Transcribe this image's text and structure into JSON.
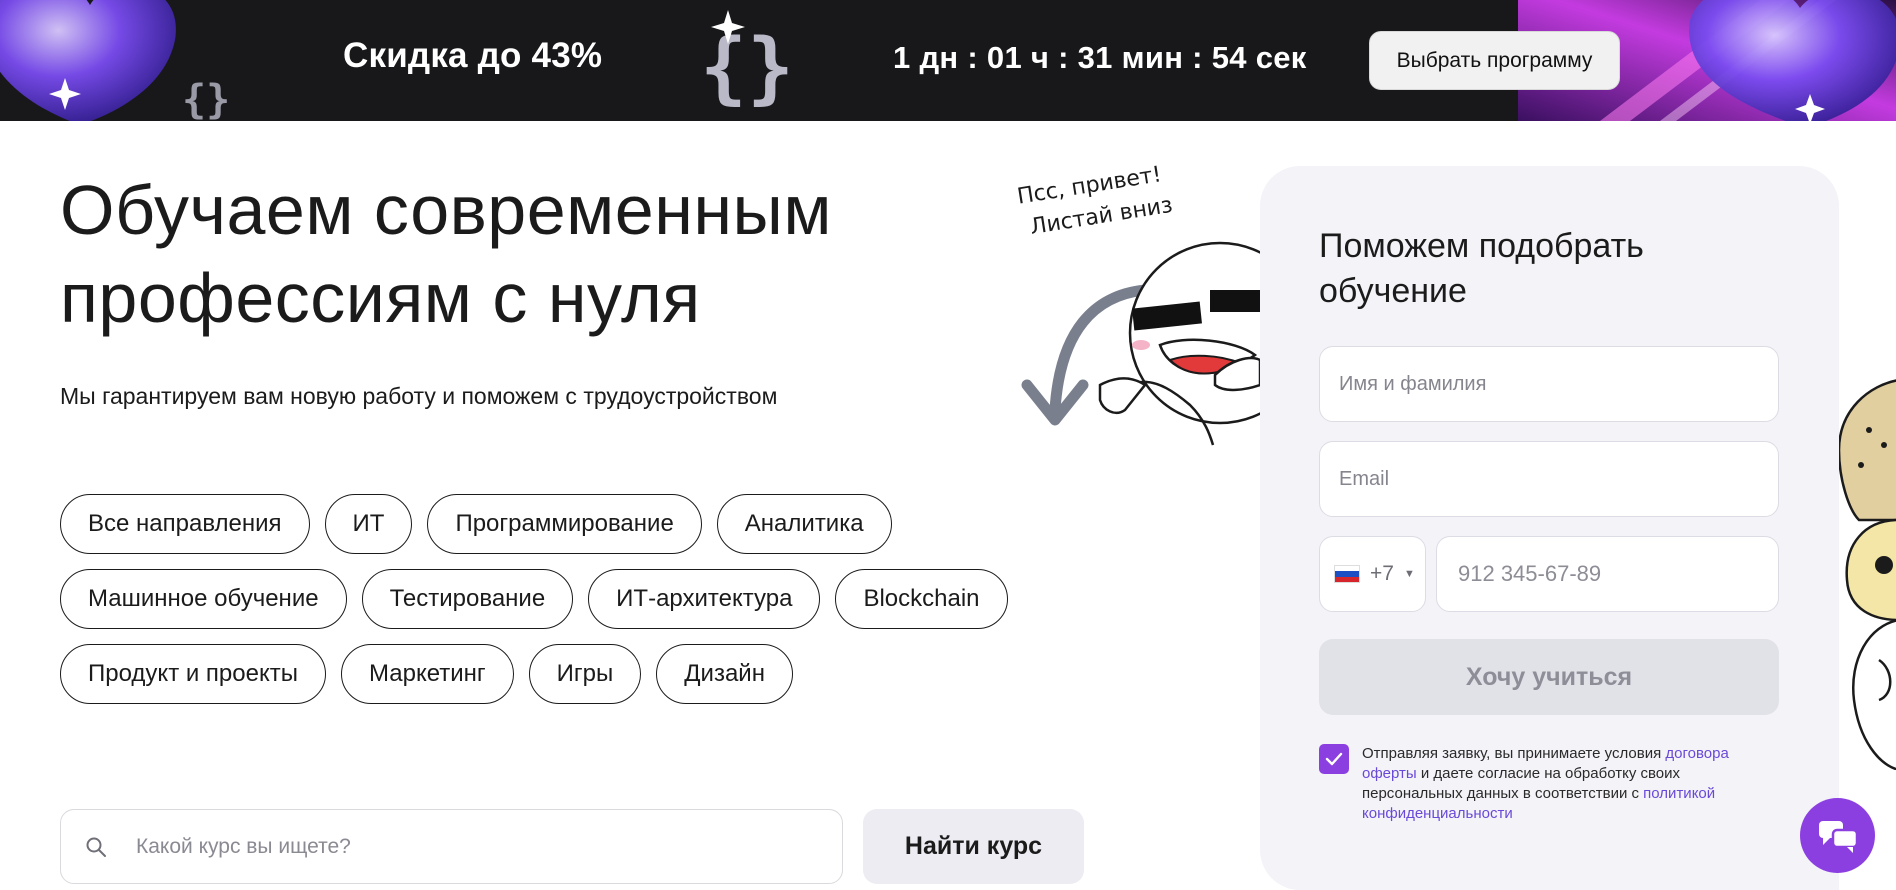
{
  "promo": {
    "sale_text": "Скидка до 43%",
    "timer": "1 дн : 01 ч : 31 мин : 54 сек",
    "cta_label": "Выбрать программу"
  },
  "hero": {
    "title_line1": "Обучаем современным",
    "title_line2": "профессиям с нуля",
    "subtitle": "Мы гарантируем вам новую работу и поможем с трудоустройством",
    "mascot_line1": "Псс, привет!",
    "mascot_line2": "Листай вниз"
  },
  "categories": {
    "row1": [
      "Все направления",
      "ИТ",
      "Программирование",
      "Аналитика"
    ],
    "row2": [
      "Машинное обучение",
      "Тестирование",
      "ИТ-архитектура",
      "Blockchain"
    ],
    "row3": [
      "Продукт и проекты",
      "Маркетинг",
      "Игры",
      "Дизайн"
    ]
  },
  "search": {
    "placeholder": "Какой курс вы ищете?",
    "button_label": "Найти курс"
  },
  "form": {
    "title": "Поможем подобрать обучение",
    "name_placeholder": "Имя и фамилия",
    "email_placeholder": "Email",
    "country_code": "+7",
    "phone_placeholder": "912 345-67-89",
    "submit_label": "Хочу учиться",
    "consent_text_1": "Отправляя заявку, вы принимаете условия ",
    "consent_link_1": "договора оферты",
    "consent_text_2": " и даете согласие на обработку своих персональных данных в соответствии с ",
    "consent_link_2": "политикой конфиденциальности",
    "consent_checked": true
  },
  "colors": {
    "accent": "#8c3fe0",
    "banner_bg": "#18181b",
    "card_bg": "#f3f3f8",
    "link": "#6a49d8"
  },
  "icons": [
    "search-icon",
    "chat-icon",
    "check-icon",
    "chevron-down-icon",
    "russia-flag-icon",
    "arrow-down-icon"
  ]
}
